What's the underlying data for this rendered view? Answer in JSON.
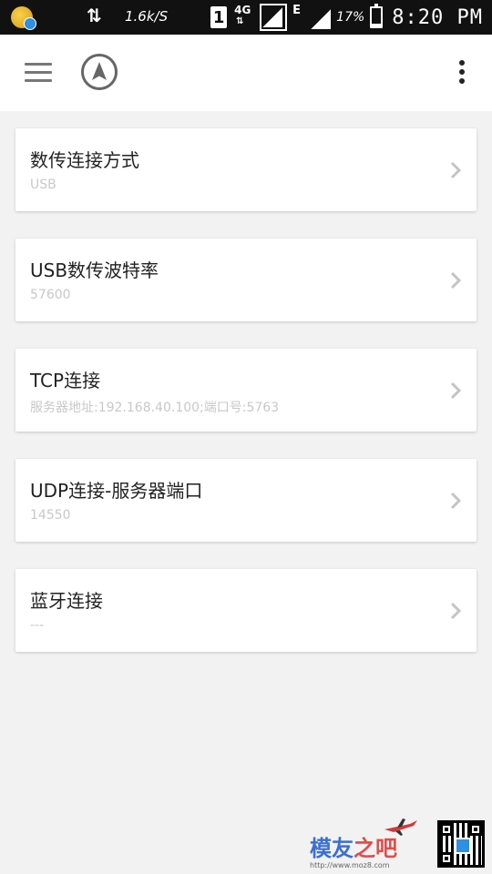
{
  "status_bar": {
    "network_speed": "1.6k/S",
    "sim_slot": "1",
    "network_type_1": "4G",
    "network_type_2": "E",
    "battery_percent": "17%",
    "battery_level": 0.17,
    "time": "8:20 PM"
  },
  "app_bar": {
    "menu_icon": "hamburger-menu-icon",
    "nav_icon": "navigation-arrow-icon",
    "overflow_icon": "more-vert-icon"
  },
  "settings": [
    {
      "title": "数传连接方式",
      "subtitle": "USB"
    },
    {
      "title": "USB数传波特率",
      "subtitle": "57600"
    },
    {
      "title": "TCP连接",
      "subtitle": "服务器地址:192.168.40.100;端口号:5763"
    },
    {
      "title": "UDP连接-服务器端口",
      "subtitle": "14550"
    },
    {
      "title": "蓝牙连接",
      "subtitle": "---"
    }
  ],
  "watermark": {
    "brand_part1": "模友",
    "brand_part2": "之吧",
    "url": "http://www.moz8.com"
  },
  "colors": {
    "background": "#f2f2f2",
    "card": "#ffffff",
    "status_bar": "#111111",
    "title_text": "#222222",
    "subtitle_text": "#c8c8c8"
  }
}
